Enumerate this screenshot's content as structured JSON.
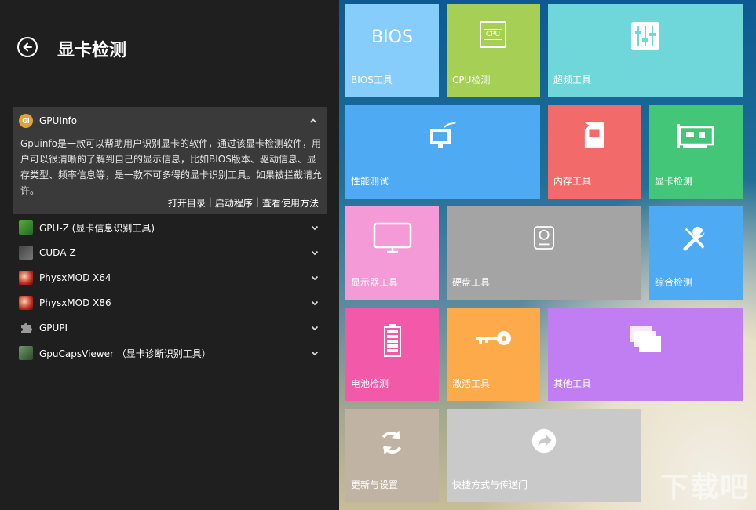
{
  "header": {
    "title": "显卡检测"
  },
  "selected_tool": {
    "name": "GPUInfo",
    "icon": "gpuinfo-icon",
    "description": "Gpuinfo是一款可以帮助用户识别显卡的软件，通过该显卡检测软件，用户可以很清晰的了解到自己的显示信息，比如BIOS版本、驱动信息、显存类型、频率信息等，是一款不可多得的显卡识别工具。如果被拦截请允许。",
    "links": [
      "打开目录",
      "启动程序",
      "查看使用方法"
    ]
  },
  "tools": [
    {
      "label": "GPU-Z (显卡信息识别工具)",
      "icon": "gpu-z-icon"
    },
    {
      "label": "CUDA-Z",
      "icon": "cuda-z-icon"
    },
    {
      "label": "PhysxMOD X64",
      "icon": "physxmod-icon"
    },
    {
      "label": "PhysxMOD X86",
      "icon": "physxmod-icon"
    },
    {
      "label": "GPUPI",
      "icon": "puzzle-icon"
    },
    {
      "label": "GpuCapsViewer （显卡诊断识别工具）",
      "icon": "gpucaps-icon"
    }
  ],
  "tiles": [
    {
      "label": "BIOS工具",
      "icon_text": "BIOS",
      "color": "#86cdfb"
    },
    {
      "label": "CPU检测",
      "icon_text": "CPU",
      "color": "#a6cf55"
    },
    {
      "label": "超频工具",
      "color": "#6fd7d9"
    },
    {
      "label": "性能测试",
      "color": "#4eaaf2"
    },
    {
      "label": "内存工具",
      "color": "#f26a6a"
    },
    {
      "label": "显卡检测",
      "color": "#44c679"
    },
    {
      "label": "显示器工具",
      "color": "#f39ad7"
    },
    {
      "label": "硬盘工具",
      "color": "#a4a4a4"
    },
    {
      "label": "综合检测",
      "color": "#4eaaf2"
    },
    {
      "label": "电池检测",
      "color": "#f25aa9"
    },
    {
      "label": "激活工具",
      "color": "#fcaa4a"
    },
    {
      "label": "其他工具",
      "color": "#c07ef2"
    },
    {
      "label": "更新与设置",
      "color": "#c1b3a4"
    },
    {
      "label": "快捷方式与传送门",
      "color": "#c9c9c9"
    }
  ],
  "watermark": "下载吧"
}
